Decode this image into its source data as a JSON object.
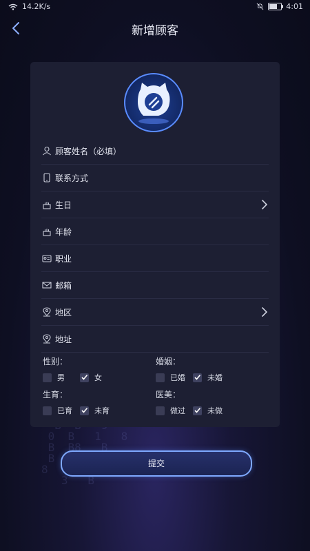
{
  "statusbar": {
    "network_speed": "14.2K/s",
    "time": "4:01"
  },
  "header": {
    "title": "新增顾客"
  },
  "form": {
    "fields": [
      {
        "label": "顾客姓名（必填）",
        "icon": "person-icon",
        "has_arrow": false
      },
      {
        "label": "联系方式",
        "icon": "phone-icon",
        "has_arrow": false
      },
      {
        "label": "生日",
        "icon": "cake-icon",
        "has_arrow": true
      },
      {
        "label": "年龄",
        "icon": "cake-icon",
        "has_arrow": false
      },
      {
        "label": "职业",
        "icon": "id-card-icon",
        "has_arrow": false
      },
      {
        "label": "邮箱",
        "icon": "mail-icon",
        "has_arrow": false
      },
      {
        "label": "地区",
        "icon": "location-icon",
        "has_arrow": true
      },
      {
        "label": "地址",
        "icon": "location-icon",
        "has_arrow": false
      }
    ]
  },
  "options": {
    "gender": {
      "title": "性别：",
      "choices": [
        {
          "label": "男",
          "checked": false
        },
        {
          "label": "女",
          "checked": true
        }
      ]
    },
    "marriage": {
      "title": "婚姻：",
      "choices": [
        {
          "label": "已婚",
          "checked": false
        },
        {
          "label": "未婚",
          "checked": true
        }
      ]
    },
    "fertility": {
      "title": "生育：",
      "choices": [
        {
          "label": "已育",
          "checked": false
        },
        {
          "label": "未育",
          "checked": true
        }
      ]
    },
    "cosmetic": {
      "title": "医美：",
      "choices": [
        {
          "label": "做过",
          "checked": false
        },
        {
          "label": "未做",
          "checked": true
        }
      ]
    }
  },
  "submit": {
    "label": "提交"
  },
  "colors": {
    "accent": "#5a8cff",
    "card": "#1d1f33",
    "background": "#0e0f22"
  }
}
